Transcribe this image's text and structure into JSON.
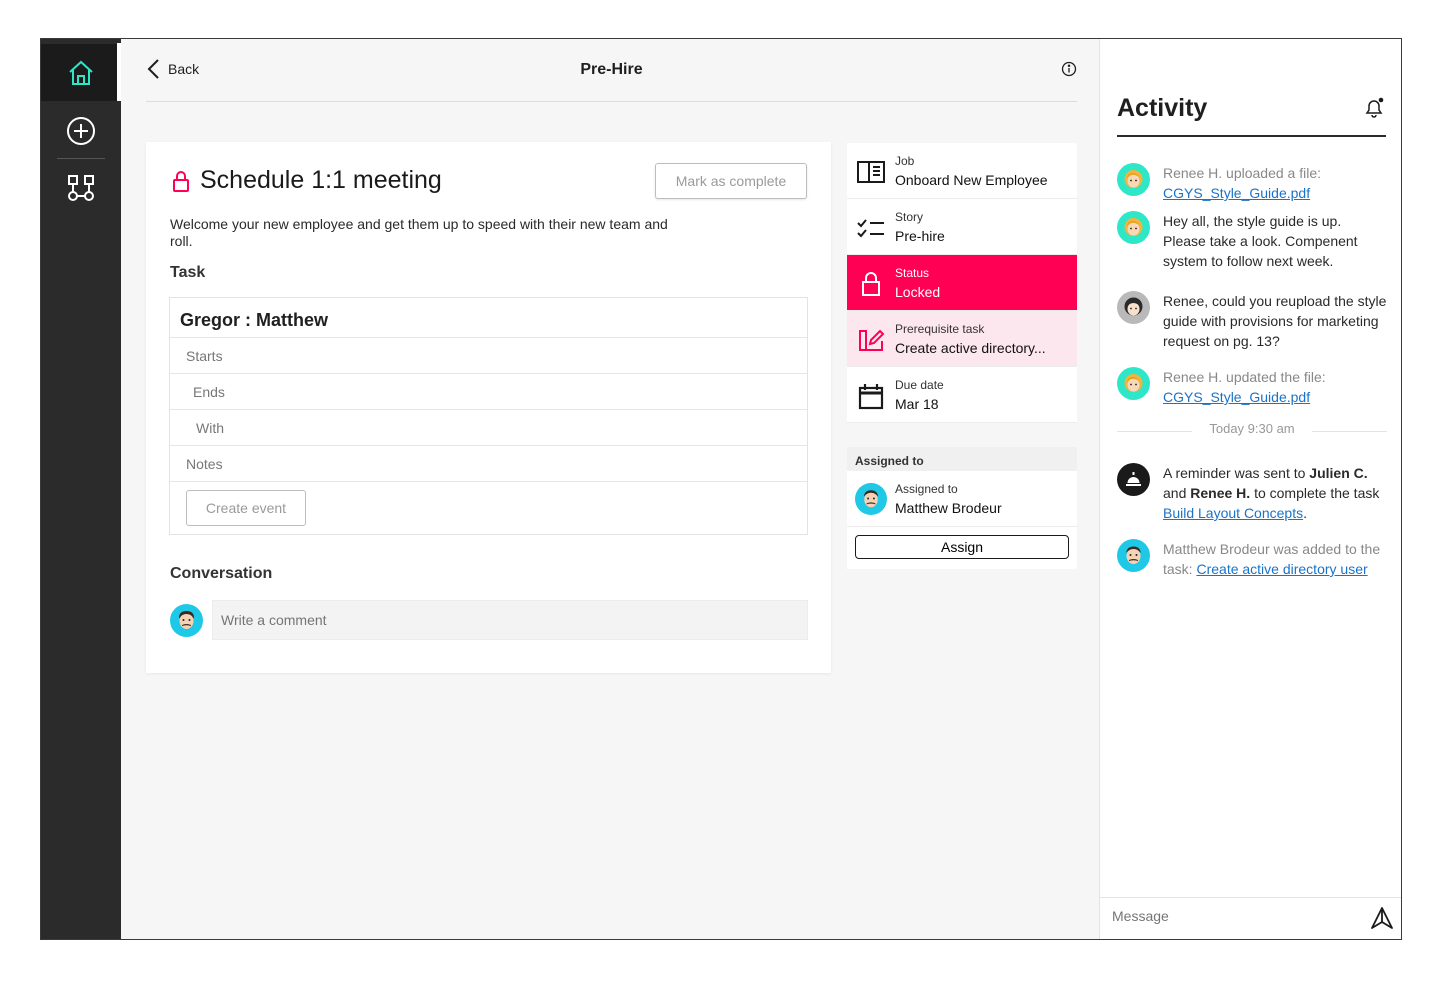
{
  "header": {
    "back_label": "Back",
    "title": "Pre-Hire"
  },
  "task": {
    "title": "Schedule 1:1 meeting",
    "mark_complete_label": "Mark as complete",
    "description": "Welcome your new employee and get them up to speed with their new team and roll.",
    "section_label": "Task",
    "participants": "Gregor : Matthew",
    "fields": [
      "Starts",
      "Ends",
      "With",
      "Notes"
    ],
    "create_event_label": "Create event",
    "conversation_label": "Conversation",
    "comment_placeholder": "Write a comment"
  },
  "details": {
    "job": {
      "label": "Job",
      "value": "Onboard New Employee"
    },
    "story": {
      "label": "Story",
      "value": "Pre-hire"
    },
    "status": {
      "label": "Status",
      "value": "Locked"
    },
    "prerequisite": {
      "label": "Prerequisite task",
      "value": "Create active directory..."
    },
    "due": {
      "label": "Due date",
      "value": "Mar 18"
    },
    "assigned_heading": "Assigned to",
    "assignee": {
      "label": "Assigned to",
      "value": "Matthew Brodeur"
    },
    "assign_label": "Assign"
  },
  "activity": {
    "title": "Activity",
    "e1": {
      "text": "Renee H. uploaded a file:",
      "link": "CGYS_Style_Guide.pdf"
    },
    "e2": {
      "text": "Hey all, the style guide is up. Please take a look. Compenent system to follow next week."
    },
    "e3": {
      "text": "Renee, could you reupload the style guide with provisions for marketing request on pg. 13?"
    },
    "e4": {
      "text": "Renee H. updated the file:",
      "link": "CGYS_Style_Guide.pdf"
    },
    "separator": "Today 9:30 am",
    "e5": {
      "pre": "A reminder was sent to",
      "name1": "Julien C.",
      "mid": "and",
      "name2": "Renee H.",
      "post": "to complete the task",
      "link": "Build Layout Concepts",
      "end": "."
    },
    "e6": {
      "text": "Matthew Brodeur was added to the task:",
      "link": "Create active directory user"
    },
    "message_placeholder": "Message"
  },
  "colors": {
    "accent_teal": "#2ee6c8",
    "status_red": "#ff0055",
    "prereq_bg": "#fde7ee",
    "link_blue": "#1a73c8"
  },
  "icons": [
    "home-icon",
    "plus-circle-icon",
    "workflow-icon",
    "chevron-left-icon",
    "info-icon",
    "lock-icon",
    "book-icon",
    "checklist-icon",
    "edit-icon",
    "calendar-icon",
    "bell-icon",
    "send-icon"
  ]
}
